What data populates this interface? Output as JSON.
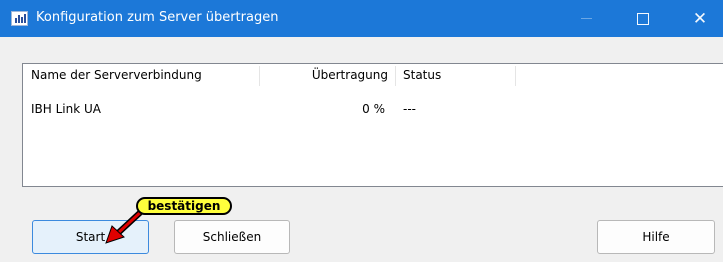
{
  "window": {
    "title": "Konfiguration zum Server übertragen"
  },
  "titlebar_buttons": {
    "maximize_icon": "maximize-icon",
    "close_icon": "close-icon",
    "close_glyph": "✕"
  },
  "list": {
    "columns": [
      "Name der Serververbindung",
      "Übertragung",
      "Status"
    ],
    "rows": [
      {
        "name": "IBH Link UA",
        "transfer": "0 %",
        "status": "---"
      }
    ]
  },
  "buttons": {
    "start": "Start",
    "close": "Schließen",
    "help": "Hilfe"
  },
  "annotation": {
    "text": "bestätigen",
    "bubble_color": "#ffff3c",
    "arrow_color": "#e00000"
  },
  "colors": {
    "titlebar": "#1c78d8",
    "dialog_bg": "#f0f0f0",
    "start_focus_border": "#3c8ade"
  }
}
